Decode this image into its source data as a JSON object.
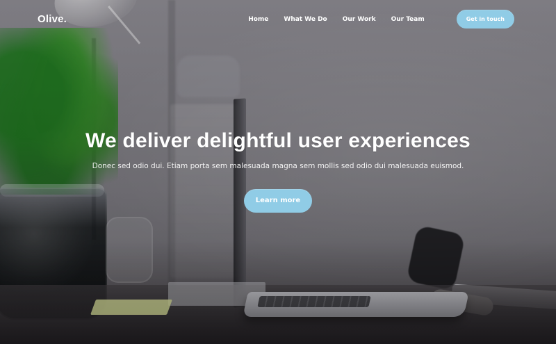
{
  "nav": {
    "brand": "Olive.",
    "links": [
      "Home",
      "What We Do",
      "Our Work",
      "Our Team"
    ],
    "cta_label": "Get in touch"
  },
  "hero": {
    "headline": "We deliver delightful user experiences",
    "subtext": "Donec sed odio dui. Etiam porta sem malesuada magna sem mollis sed odio dui malesuada euismod.",
    "button_label": "Learn more"
  },
  "colors": {
    "button": "#90CCE6",
    "text": "#FFFFFF"
  }
}
